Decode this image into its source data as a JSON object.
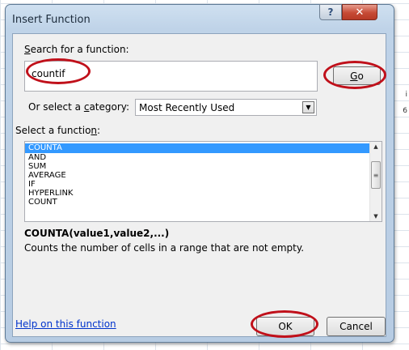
{
  "window": {
    "title": "Insert Function",
    "help_glyph": "?",
    "close_glyph": "✕"
  },
  "search": {
    "label_prefix": "",
    "label_accel": "S",
    "label_rest": "earch for a function:",
    "value": "countif",
    "go_label_accel": "G",
    "go_label_rest": "o"
  },
  "category": {
    "label_before": "Or select a ",
    "label_accel": "c",
    "label_after": "ategory:",
    "selected": "Most Recently Used"
  },
  "function_list": {
    "label_before": "Select a functio",
    "label_accel": "n",
    "label_after": ":",
    "items": [
      "COUNTA",
      "AND",
      "SUM",
      "AVERAGE",
      "IF",
      "HYPERLINK",
      "COUNT"
    ],
    "selected_index": 0
  },
  "details": {
    "signature": "COUNTA(value1,value2,...)",
    "description": "Counts the number of cells in a range that are not empty."
  },
  "footer": {
    "help_link": "Help on this function",
    "ok_label": "OK",
    "cancel_label": "Cancel"
  },
  "background": {
    "edge_text_1": "i",
    "edge_text_2": "6"
  },
  "colors": {
    "selection": "#3399ff",
    "annotation": "#c0101a",
    "link": "#0033cc"
  }
}
